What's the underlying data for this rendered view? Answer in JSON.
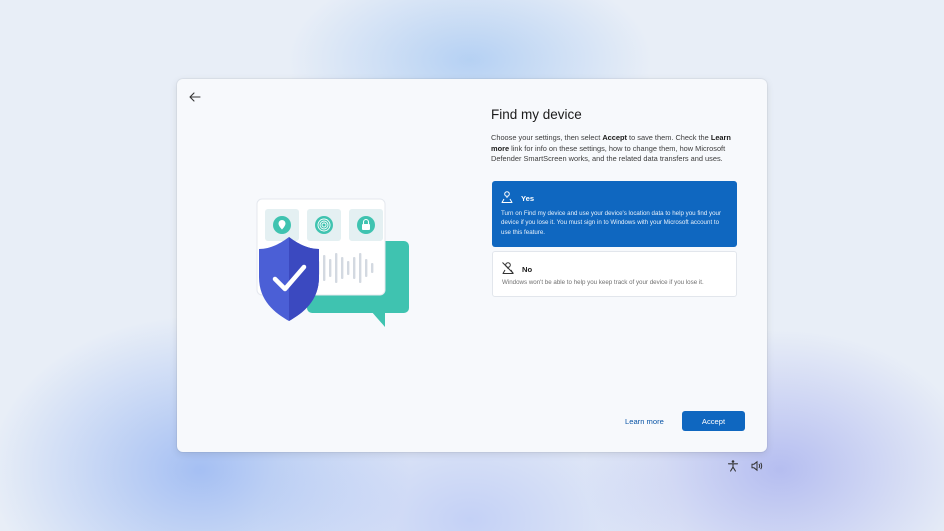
{
  "dialog": {
    "back_icon": "arrow-left-icon",
    "title": "Find my device",
    "description": {
      "part1": "Choose your settings, then select ",
      "bold1": "Accept",
      "part2": " to save them. Check the ",
      "bold2": "Learn more",
      "part3": " link for info on these settings, how to change them, how Microsoft Defender SmartScreen works, and the related data transfers and uses."
    },
    "options": [
      {
        "label": "Yes",
        "icon": "location-person-icon",
        "selected": true,
        "text": "Turn on Find my device and use your device's location data to help you find your device if you lose it. You must sign in to Windows with your Microsoft account to use this feature."
      },
      {
        "label": "No",
        "icon": "location-off-icon",
        "selected": false,
        "text": "Windows won't be able to help you keep track of your device if you lose it."
      }
    ],
    "learn_more": "Learn more",
    "accept": "Accept"
  },
  "illustration": {
    "icons": [
      "location-pin-icon",
      "fingerprint-icon",
      "lock-icon",
      "shield-check-icon",
      "chat-bubble-icon"
    ]
  },
  "taskbar": {
    "icons": [
      "accessibility-icon",
      "volume-icon"
    ]
  },
  "colors": {
    "accent": "#0f67c0",
    "teal": "#3fc3b0",
    "shield": "#4b5fd6"
  }
}
